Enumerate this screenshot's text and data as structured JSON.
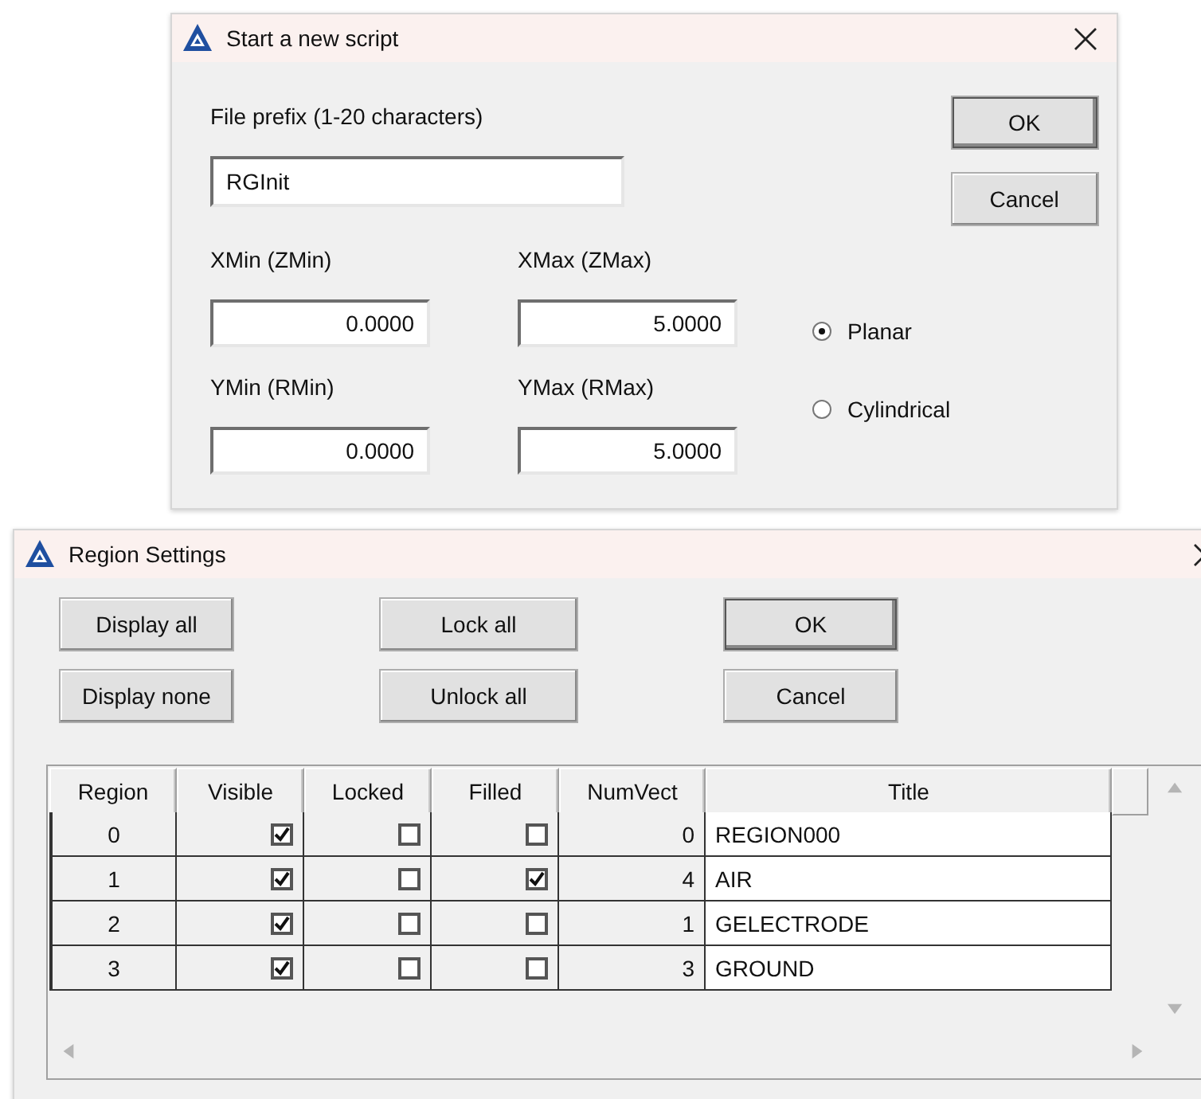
{
  "script_dialog": {
    "title": "Start a new script",
    "prefix_label": "File prefix (1-20 characters)",
    "prefix_value": "RGInit",
    "fields": [
      {
        "label": "XMin (ZMin)",
        "value": "0.0000"
      },
      {
        "label": "XMax (ZMax)",
        "value": "5.0000"
      },
      {
        "label": "YMin (RMin)",
        "value": "0.0000"
      },
      {
        "label": "YMax (RMax)",
        "value": "5.0000"
      }
    ],
    "radios": [
      {
        "label": "Planar",
        "selected": true
      },
      {
        "label": "Cylindrical",
        "selected": false
      }
    ],
    "buttons": [
      {
        "label": "OK",
        "default": true
      },
      {
        "label": "Cancel",
        "default": false
      }
    ]
  },
  "region_dialog": {
    "title": "Region Settings",
    "button_rows": [
      [
        {
          "label": "Display all",
          "default": false
        },
        {
          "label": "Lock all",
          "default": false
        },
        {
          "label": "OK",
          "default": true
        }
      ],
      [
        {
          "label": "Display none",
          "default": false
        },
        {
          "label": "Unlock all",
          "default": false
        },
        {
          "label": "Cancel",
          "default": false
        }
      ]
    ],
    "table": {
      "columns": [
        "Region",
        "Visible",
        "Locked",
        "Filled",
        "NumVect",
        "Title"
      ],
      "rows": [
        {
          "region": "0",
          "visible": true,
          "locked": false,
          "filled": false,
          "numvect": "0",
          "title": "REGION000"
        },
        {
          "region": "1",
          "visible": true,
          "locked": false,
          "filled": true,
          "numvect": "4",
          "title": "AIR"
        },
        {
          "region": "2",
          "visible": true,
          "locked": false,
          "filled": false,
          "numvect": "1",
          "title": "GELECTRODE"
        },
        {
          "region": "3",
          "visible": true,
          "locked": false,
          "filled": false,
          "numvect": "3",
          "title": "GROUND"
        }
      ]
    }
  }
}
